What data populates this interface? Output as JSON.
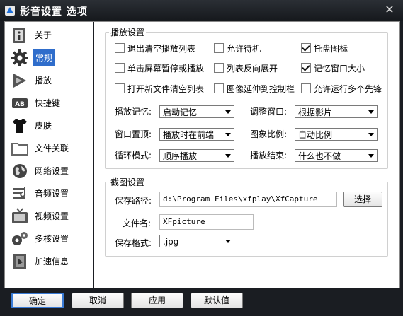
{
  "window": {
    "title": "影音设置 选项",
    "close_symbol": "✕"
  },
  "sidebar": {
    "items": [
      {
        "label": "关于"
      },
      {
        "label": "常规"
      },
      {
        "label": "播放"
      },
      {
        "label": "快捷键"
      },
      {
        "label": "皮肤"
      },
      {
        "label": "文件关联"
      },
      {
        "label": "网络设置"
      },
      {
        "label": "音频设置"
      },
      {
        "label": "视频设置"
      },
      {
        "label": "多核设置"
      },
      {
        "label": "加速信息"
      }
    ],
    "active_index": 1,
    "hotkey_icon_text": "AB"
  },
  "playback": {
    "title": "播放设置",
    "checkboxes": [
      {
        "label": "退出清空播放列表",
        "checked": false
      },
      {
        "label": "允许待机",
        "checked": false
      },
      {
        "label": "托盘图标",
        "checked": true
      },
      {
        "label": "单击屏幕暂停或播放",
        "checked": false
      },
      {
        "label": "列表反向展开",
        "checked": false
      },
      {
        "label": "记忆窗口大小",
        "checked": true
      },
      {
        "label": "打开新文件清空列表",
        "checked": false
      },
      {
        "label": "图像延伸到控制栏",
        "checked": false
      },
      {
        "label": "允许运行多个先锋",
        "checked": false
      }
    ],
    "selects": [
      {
        "label": "播放记忆:",
        "value": "启动记忆"
      },
      {
        "label": "调整窗口:",
        "value": "根据影片"
      },
      {
        "label": "窗口置顶:",
        "value": "播放时在前端"
      },
      {
        "label": "图象比例:",
        "value": "自动比例"
      },
      {
        "label": "循环模式:",
        "value": "顺序播放"
      },
      {
        "label": "播放结束:",
        "value": "什么也不做"
      }
    ]
  },
  "capture": {
    "title": "截图设置",
    "path_label": "保存路径:",
    "path_value": "d:\\Program Files\\xfplay\\XfCapture",
    "browse_label": "选择",
    "filename_label": "文件名:",
    "filename_value": "XFpicture",
    "format_label": "保存格式:",
    "format_value": ".jpg"
  },
  "footer": {
    "ok_label": "确定",
    "cancel_label": "取消",
    "apply_label": "应用",
    "default_label": "默认值"
  }
}
